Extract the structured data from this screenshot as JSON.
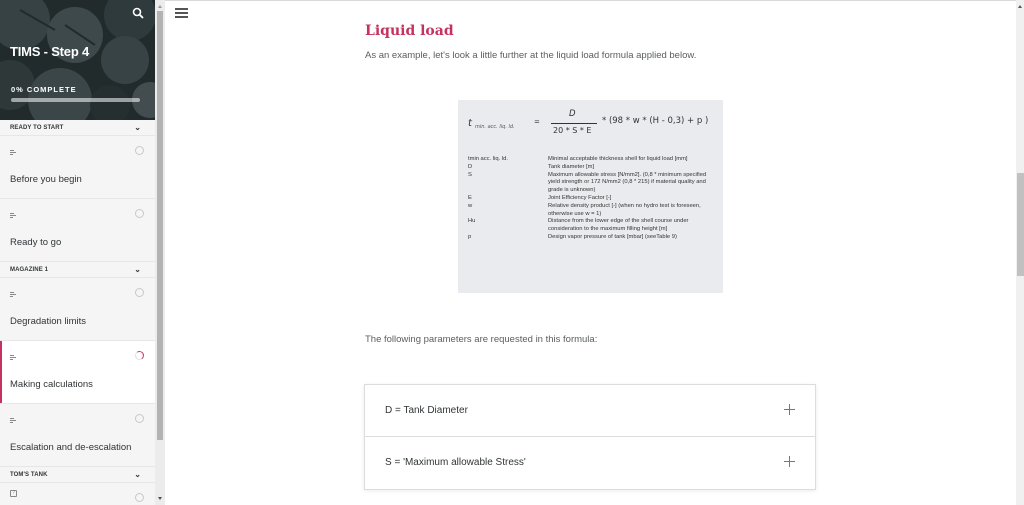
{
  "sidebar": {
    "course_title": "TIMS - Step 4",
    "progress_label": "0% COMPLETE",
    "progress_percent": 0,
    "search_icon": "search-icon",
    "sections": [
      {
        "title": "READY TO START",
        "items": [
          {
            "label": "Before you begin",
            "type": "lesson",
            "status": "not-started"
          },
          {
            "label": "Ready to go",
            "type": "lesson",
            "status": "not-started"
          }
        ]
      },
      {
        "title": "MAGAZINE 1",
        "items": [
          {
            "label": "Degradation limits",
            "type": "lesson",
            "status": "not-started"
          },
          {
            "label": "Making calculations",
            "type": "lesson",
            "status": "in-progress",
            "active": true
          },
          {
            "label": "Escalation and de-escalation",
            "type": "lesson",
            "status": "not-started"
          }
        ]
      },
      {
        "title": "TOM'S TANK",
        "items": [
          {
            "label": "",
            "type": "quiz",
            "status": "not-started"
          }
        ]
      }
    ]
  },
  "header": {
    "menu_icon": "hamburger-menu-icon"
  },
  "content": {
    "heading": "Liquid load",
    "intro": "As an example, let's look a little further at the liquid load formula applied below.",
    "formula": {
      "lhs": "t",
      "lhs_subscript": "min. acc. liq. ld.",
      "equals": "=",
      "numerator": "D",
      "denominator": "20 * S * E",
      "rest": "* (98 * w * (H - 0,3) + p )",
      "definitions": [
        {
          "symbol": "tmin acc. liq. ld.",
          "description": "Minimal acceptable thickness shell for liquid load [mm]"
        },
        {
          "symbol": "D",
          "description": "Tank diameter [m]"
        },
        {
          "symbol": "S",
          "description": "Maximum allowable stress [N/mm2]. (0,8 * minimum specified yield strength or 172 N/mm2 (0,8 * 215) if material quality and grade is unknown)"
        },
        {
          "symbol": "E",
          "description": "Joint Efficiency Factor [-]"
        },
        {
          "symbol": "w",
          "description": "Relative density product [-] (when no hydro test is foreseen, otherwise use w = 1)"
        },
        {
          "symbol": "Hu",
          "description": "Distance from the lower edge of the shell course under consideration to the maximum filling height [m]"
        },
        {
          "symbol": "p",
          "description": "Design vapor pressure of tank [mbar] (seeTable 9)"
        }
      ]
    },
    "params_text": "The following parameters are requested in this formula:",
    "accordion": [
      {
        "title": "D = Tank Diameter",
        "expanded": false
      },
      {
        "title": "S = 'Maximum allowable Stress'",
        "expanded": false
      }
    ]
  },
  "colors": {
    "accent": "#c6325f",
    "text": "#313537",
    "muted_text": "#5a5e60",
    "sidebar_bg": "#f5f5f5",
    "formula_bg": "#e9ebee"
  }
}
